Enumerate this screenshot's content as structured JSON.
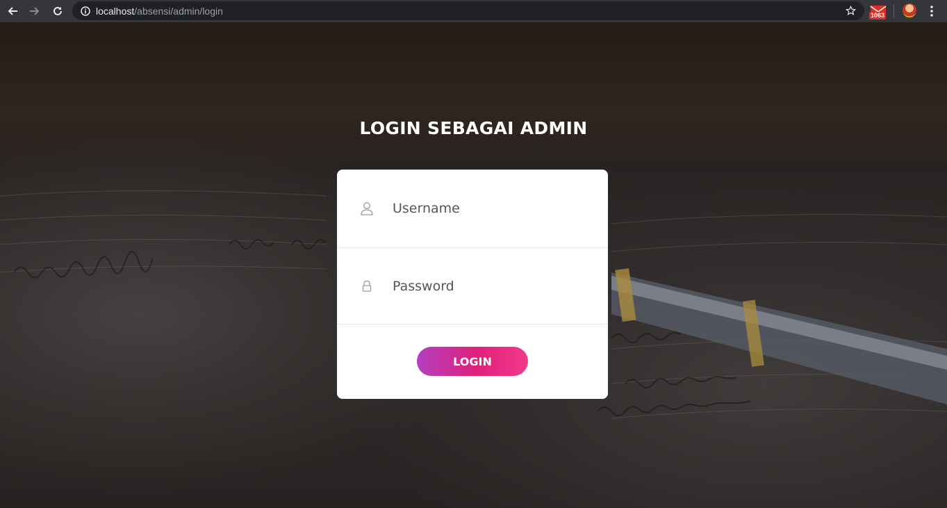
{
  "browser": {
    "url_host": "localhost",
    "url_path": "/absensi/admin/login",
    "extension_badge": "1063"
  },
  "page": {
    "title": "LOGIN SEBAGAI ADMIN",
    "username_placeholder": "Username",
    "password_placeholder": "Password",
    "login_label": "LOGIN"
  },
  "colors": {
    "button_gradient_start": "#b23fc0",
    "button_gradient_end": "#f23b8b",
    "card_background": "#ffffff"
  }
}
